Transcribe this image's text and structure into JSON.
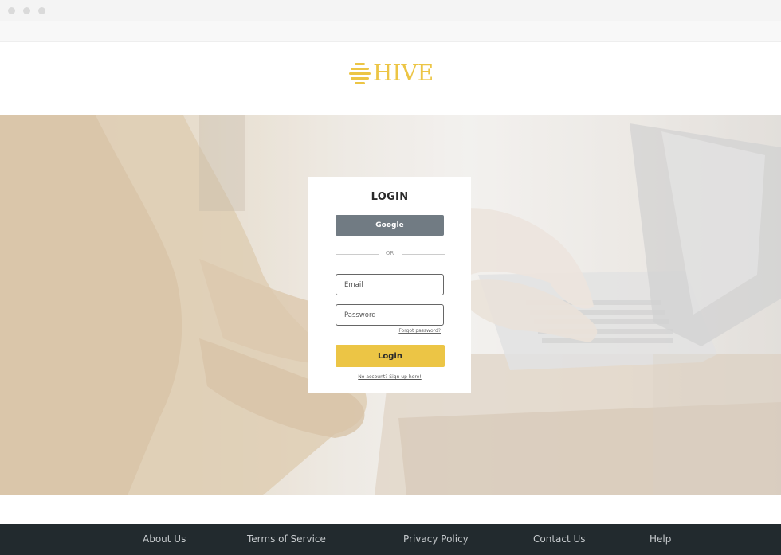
{
  "header": {
    "logo_text": "HIVE",
    "logo_icon": "hive-stripes-icon"
  },
  "login": {
    "title": "LOGIN",
    "google_label": "Google",
    "or_label": "OR",
    "email_placeholder": "Email",
    "password_placeholder": "Password",
    "forgot_label": "Forgot password?",
    "login_label": "Login",
    "signup_label": "No account? Sign up here!"
  },
  "footer": {
    "links": [
      "About Us",
      "Terms of Service",
      "Privacy Policy",
      "Contact Us",
      "Help"
    ]
  },
  "colors": {
    "accent": "#ecc545",
    "google_button": "#717b83",
    "footer_bg": "#222a2e"
  }
}
